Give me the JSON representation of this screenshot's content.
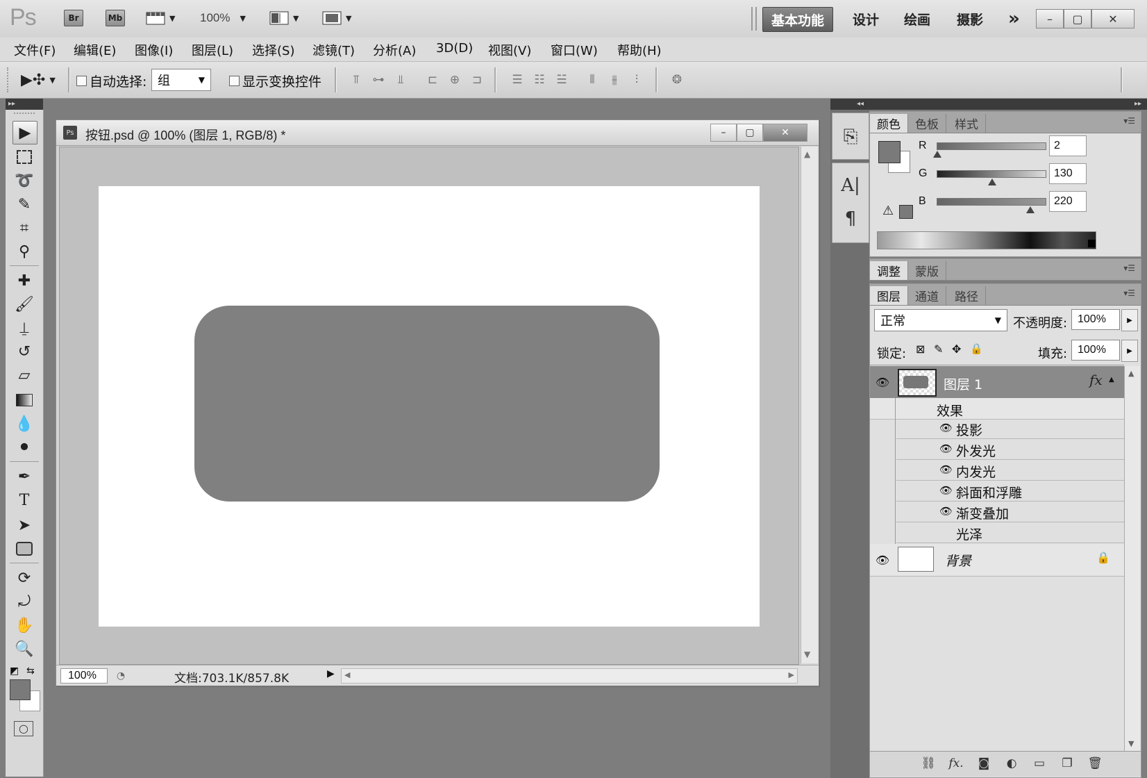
{
  "titlebar": {
    "app_logo": "Ps",
    "br_label": "Br",
    "mb_label": "Mb",
    "zoom": "100%",
    "workspaces": [
      "基本功能",
      "设计",
      "绘画",
      "摄影"
    ],
    "more": "»",
    "controls": {
      "minimize": "–",
      "restore": "▢",
      "close": "✕"
    }
  },
  "menubar": {
    "items": [
      "文件(F)",
      "编辑(E)",
      "图像(I)",
      "图层(L)",
      "选择(S)",
      "滤镜(T)",
      "分析(A)",
      "3D(D)",
      "视图(V)",
      "窗口(W)",
      "帮助(H)"
    ]
  },
  "options": {
    "auto_select_label": "自动选择:",
    "auto_select_value": "组",
    "show_transform_label": "显示变换控件"
  },
  "tools": {
    "icons": [
      "move-icon",
      "marquee-icon",
      "lasso-icon",
      "quick-select-icon",
      "crop-icon",
      "eyedropper-icon",
      "healing-icon",
      "brush-icon",
      "stamp-icon",
      "history-brush-icon",
      "eraser-icon",
      "gradient-icon",
      "blur-icon",
      "dodge-icon",
      "pen-icon",
      "type-icon",
      "path-select-icon",
      "shape-icon",
      "3d-rotate-icon",
      "3d-orbit-icon",
      "hand-icon",
      "zoom-icon"
    ]
  },
  "document": {
    "title": "按钮.psd @ 100% (图层 1, RGB/8) *",
    "zoom": "100%",
    "status": "文档:703.1K/857.8K",
    "shape_color": "#808080"
  },
  "color_panel": {
    "tabs": [
      "颜色",
      "色板",
      "样式"
    ],
    "r_label": "R",
    "g_label": "G",
    "b_label": "B",
    "r_value": "2",
    "g_value": "130",
    "b_value": "220",
    "r_level": 2,
    "g_level": 130,
    "b_level": 220
  },
  "adjust_panel": {
    "tabs": [
      "调整",
      "蒙版"
    ]
  },
  "layers_panel": {
    "tabs": [
      "图层",
      "通道",
      "路径"
    ],
    "blend_mode": "正常",
    "opacity_label": "不透明度:",
    "opacity_value": "100%",
    "lock_label": "锁定:",
    "fill_label": "填充:",
    "fill_value": "100%",
    "layer1_name": "图层 1",
    "fx_badge": "fx",
    "effects_label": "效果",
    "effects": [
      "投影",
      "外发光",
      "内发光",
      "斜面和浮雕",
      "渐变叠加",
      "光泽"
    ],
    "background_name": "背景"
  }
}
